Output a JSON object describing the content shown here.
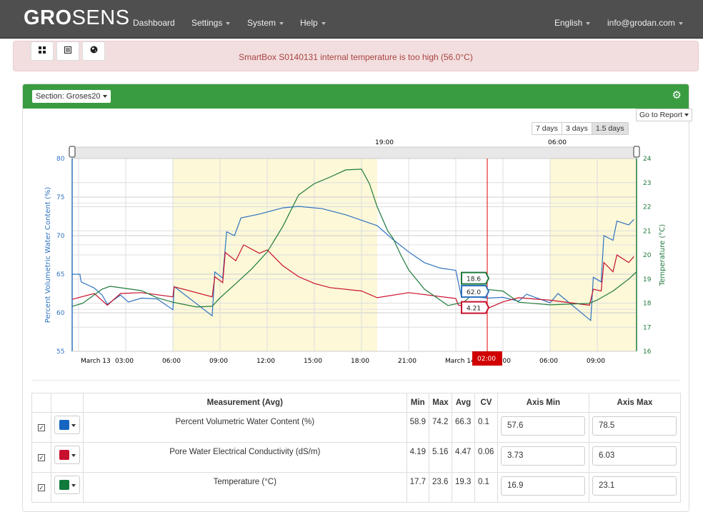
{
  "nav": {
    "logo_bold": "GRO",
    "logo_light": "SENS",
    "items": [
      "Dashboard",
      "Settings",
      "System",
      "Help"
    ],
    "language": "English",
    "user": "info@grodan.com"
  },
  "toolbar": {
    "icons": [
      "grid-icon",
      "list-icon",
      "globe-icon"
    ]
  },
  "alert": {
    "message": "SmartBox S0140131 internal temperature is too high (56.0°C)"
  },
  "panel": {
    "section_label": "Section: Groses20",
    "report_label": "Go to Report",
    "ranges": [
      "7 days",
      "3 days",
      "1.5 days"
    ],
    "selected_range": "1.5 days"
  },
  "colors": {
    "vwc": "#2f73c0",
    "ec": "#c8102e",
    "temp": "#1f7a3c",
    "header": "#3a9c41",
    "night_band": "#fcf8d8",
    "cursor": "#e00000"
  },
  "chart_data": {
    "type": "line",
    "navigator_labels": [
      "19:00",
      "06:00"
    ],
    "x_ticks": [
      "March 13",
      "03:00",
      "06:00",
      "09:00",
      "12:00",
      "15:00",
      "18:00",
      "21:00",
      "March 14",
      "03:00",
      "06:00",
      "09:00"
    ],
    "x_range": [
      "Mar 12 23:35",
      "Mar 14 11:30"
    ],
    "left_axis": {
      "label": "Percent Volumetric Water Content (%)",
      "range": [
        55,
        80
      ],
      "ticks": [
        "55",
        "60",
        "65",
        "70",
        "75",
        "80"
      ]
    },
    "right_axis": {
      "label": "Temperature (°C)",
      "range": [
        16,
        24
      ],
      "ticks": [
        "16",
        "17",
        "18",
        "19",
        "20",
        "21",
        "22",
        "23",
        "24"
      ]
    },
    "shaded_periods": [
      [
        "Mar 13 06:00",
        "Mar 13 19:00"
      ],
      [
        "Mar 14 06:00",
        "Mar 14 11:30"
      ]
    ],
    "cursor": {
      "time_label": "02:00",
      "time": "Mar 14 02:00",
      "values": {
        "temp": "18.6",
        "vwc": "62.0",
        "ec": "4.21"
      }
    },
    "series": [
      {
        "key": "vwc",
        "axis": "left",
        "range": [
          55,
          80
        ],
        "points": [
          [
            "Mar 12 23:35",
            65.0
          ],
          [
            "Mar 13 00:05",
            65.0
          ],
          [
            "Mar 13 00:10",
            64.0
          ],
          [
            "Mar 13 01:00",
            63.2
          ],
          [
            "Mar 13 01:30",
            62.3
          ],
          [
            "Mar 13 01:50",
            61.1
          ],
          [
            "Mar 13 02:40",
            62.3
          ],
          [
            "Mar 13 03:10",
            61.4
          ],
          [
            "Mar 13 04:00",
            61.9
          ],
          [
            "Mar 13 05:00",
            61.8
          ],
          [
            "Mar 13 06:00",
            60.4
          ],
          [
            "Mar 13 06:05",
            63.4
          ],
          [
            "Mar 13 08:30",
            59.6
          ],
          [
            "Mar 13 08:40",
            65.3
          ],
          [
            "Mar 13 09:10",
            64.5
          ],
          [
            "Mar 13 09:25",
            70.5
          ],
          [
            "Mar 13 09:55",
            70.0
          ],
          [
            "Mar 13 10:20",
            72.3
          ],
          [
            "Mar 13 11:30",
            72.8
          ],
          [
            "Mar 13 13:00",
            73.6
          ],
          [
            "Mar 13 14:00",
            73.8
          ],
          [
            "Mar 13 15:30",
            73.5
          ],
          [
            "Mar 13 17:00",
            72.7
          ],
          [
            "Mar 13 18:00",
            72.0
          ],
          [
            "Mar 13 19:00",
            71.3
          ],
          [
            "Mar 13 20:00",
            69.5
          ],
          [
            "Mar 13 21:00",
            67.9
          ],
          [
            "Mar 13 22:00",
            66.5
          ],
          [
            "Mar 13 23:00",
            65.8
          ],
          [
            "Mar 14 00:00",
            65.5
          ],
          [
            "Mar 14 00:20",
            62.3
          ],
          [
            "Mar 14 02:00",
            61.9
          ],
          [
            "Mar 14 03:00",
            62.0
          ],
          [
            "Mar 14 04:00",
            61.5
          ],
          [
            "Mar 14 04:30",
            62.4
          ],
          [
            "Mar 14 06:00",
            61.3
          ],
          [
            "Mar 14 06:30",
            62.5
          ],
          [
            "Mar 14 08:35",
            59.0
          ],
          [
            "Mar 14 08:45",
            64.6
          ],
          [
            "Mar 14 09:15",
            64.0
          ],
          [
            "Mar 14 09:25",
            70.0
          ],
          [
            "Mar 14 10:00",
            69.4
          ],
          [
            "Mar 14 10:15",
            71.9
          ],
          [
            "Mar 14 11:00",
            71.4
          ],
          [
            "Mar 14 11:20",
            72.1
          ]
        ]
      },
      {
        "key": "ec",
        "axis": "hidden",
        "range": [
          3.73,
          6.03
        ],
        "points": [
          [
            "Mar 12 23:35",
            4.35
          ],
          [
            "Mar 13 01:00",
            4.42
          ],
          [
            "Mar 13 01:50",
            4.28
          ],
          [
            "Mar 13 02:40",
            4.42
          ],
          [
            "Mar 13 04:00",
            4.43
          ],
          [
            "Mar 13 06:00",
            4.38
          ],
          [
            "Mar 13 06:05",
            4.5
          ],
          [
            "Mar 13 08:30",
            4.38
          ],
          [
            "Mar 13 08:40",
            4.62
          ],
          [
            "Mar 13 09:10",
            4.55
          ],
          [
            "Mar 13 09:20",
            4.91
          ],
          [
            "Mar 13 10:00",
            4.81
          ],
          [
            "Mar 13 10:30",
            5.0
          ],
          [
            "Mar 13 11:30",
            4.9
          ],
          [
            "Mar 13 12:00",
            4.94
          ],
          [
            "Mar 13 13:00",
            4.75
          ],
          [
            "Mar 13 14:00",
            4.62
          ],
          [
            "Mar 13 15:00",
            4.54
          ],
          [
            "Mar 13 16:00",
            4.49
          ],
          [
            "Mar 13 18:00",
            4.45
          ],
          [
            "Mar 13 19:00",
            4.37
          ],
          [
            "Mar 13 21:00",
            4.43
          ],
          [
            "Mar 14 00:00",
            4.36
          ],
          [
            "Mar 14 00:10",
            4.28
          ],
          [
            "Mar 14 02:00",
            4.24
          ],
          [
            "Mar 14 03:00",
            4.32
          ],
          [
            "Mar 14 04:00",
            4.37
          ],
          [
            "Mar 14 06:00",
            4.34
          ],
          [
            "Mar 14 08:30",
            4.28
          ],
          [
            "Mar 14 08:45",
            4.47
          ],
          [
            "Mar 14 09:15",
            4.45
          ],
          [
            "Mar 14 09:25",
            4.79
          ],
          [
            "Mar 14 10:00",
            4.68
          ],
          [
            "Mar 14 10:15",
            4.88
          ],
          [
            "Mar 14 11:00",
            4.79
          ],
          [
            "Mar 14 11:20",
            4.86
          ]
        ]
      },
      {
        "key": "temp",
        "axis": "right",
        "range": [
          16,
          24
        ],
        "points": [
          [
            "Mar 12 23:35",
            17.87
          ],
          [
            "Mar 13 00:15",
            17.99
          ],
          [
            "Mar 13 01:30",
            18.58
          ],
          [
            "Mar 13 02:00",
            18.7
          ],
          [
            "Mar 13 04:00",
            18.52
          ],
          [
            "Mar 13 05:00",
            18.22
          ],
          [
            "Mar 13 06:00",
            18.04
          ],
          [
            "Mar 13 07:30",
            17.84
          ],
          [
            "Mar 13 08:30",
            17.87
          ],
          [
            "Mar 13 09:00",
            18.22
          ],
          [
            "Mar 13 10:00",
            18.81
          ],
          [
            "Mar 13 11:00",
            19.41
          ],
          [
            "Mar 13 12:00",
            20.12
          ],
          [
            "Mar 13 13:00",
            21.19
          ],
          [
            "Mar 13 14:00",
            22.49
          ],
          [
            "Mar 13 15:00",
            22.96
          ],
          [
            "Mar 13 16:00",
            23.23
          ],
          [
            "Mar 13 17:00",
            23.53
          ],
          [
            "Mar 13 18:00",
            23.56
          ],
          [
            "Mar 13 18:30",
            22.96
          ],
          [
            "Mar 13 19:00",
            21.99
          ],
          [
            "Mar 13 19:40",
            21.0
          ],
          [
            "Mar 13 20:00",
            20.7
          ],
          [
            "Mar 13 20:30",
            20.0
          ],
          [
            "Mar 13 21:00",
            19.38
          ],
          [
            "Mar 13 22:00",
            18.58
          ],
          [
            "Mar 13 23:00",
            18.13
          ],
          [
            "Mar 13 23:30",
            17.9
          ],
          [
            "Mar 14 00:30",
            18.04
          ],
          [
            "Mar 14 01:30",
            18.6
          ],
          [
            "Mar 14 03:00",
            18.5
          ],
          [
            "Mar 14 04:00",
            18.04
          ],
          [
            "Mar 14 06:00",
            17.93
          ],
          [
            "Mar 14 08:30",
            17.99
          ],
          [
            "Mar 14 09:00",
            18.13
          ],
          [
            "Mar 14 10:00",
            18.5
          ],
          [
            "Mar 14 11:00",
            19.0
          ],
          [
            "Mar 14 11:30",
            19.3
          ]
        ]
      }
    ]
  },
  "table": {
    "headers": [
      "",
      "",
      "Measurement (Avg)",
      "Min",
      "Max",
      "Avg",
      "CV",
      "Axis Min",
      "Axis Max"
    ],
    "rows": [
      {
        "checked": true,
        "color": "#1565c0",
        "name": "Percent Volumetric Water Content (%)",
        "min": "58.9",
        "max": "74.2",
        "avg": "66.3",
        "cv": "0.1",
        "axis_min": "57.6",
        "axis_max": "78.5"
      },
      {
        "checked": true,
        "color": "#c8102e",
        "name": "Pore Water Electrical Conductivity (dS/m)",
        "min": "4.19",
        "max": "5.16",
        "avg": "4.47",
        "cv": "0.06",
        "axis_min": "3.73",
        "axis_max": "6.03"
      },
      {
        "checked": true,
        "color": "#0f7a3c",
        "name": "Temperature (°C)",
        "min": "17.7",
        "max": "23.6",
        "avg": "19.3",
        "cv": "0.1",
        "axis_min": "16.9",
        "axis_max": "23.1"
      }
    ]
  }
}
